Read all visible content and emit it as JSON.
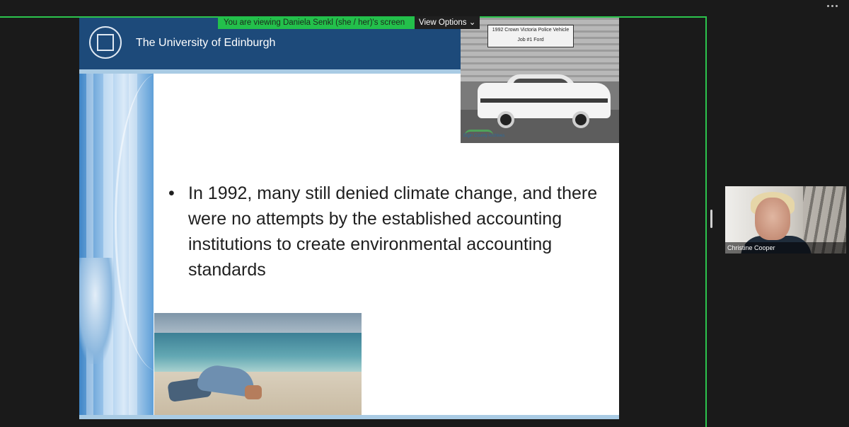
{
  "screen_share": {
    "viewing_banner": "You are viewing Daniela Senkl (she / her)'s screen",
    "view_options_label": "View Options",
    "view_options_icon": "chevron-down-icon",
    "banner_color": "#23c04b"
  },
  "slide": {
    "university_name": "The University of Edinburgh",
    "header_color": "#1d4a7a",
    "car_photo": {
      "sign_line1": "1992 Crown Victoria Police Vehicle",
      "sign_line2": "Job #1 Ford",
      "archive_label": "Elgin County Archives"
    },
    "bullet_text": "In 1992, many still denied climate change, and there were no attempts by the established accounting institutions to create environmental accounting standards"
  },
  "participant": {
    "name": "Christine Cooper"
  }
}
